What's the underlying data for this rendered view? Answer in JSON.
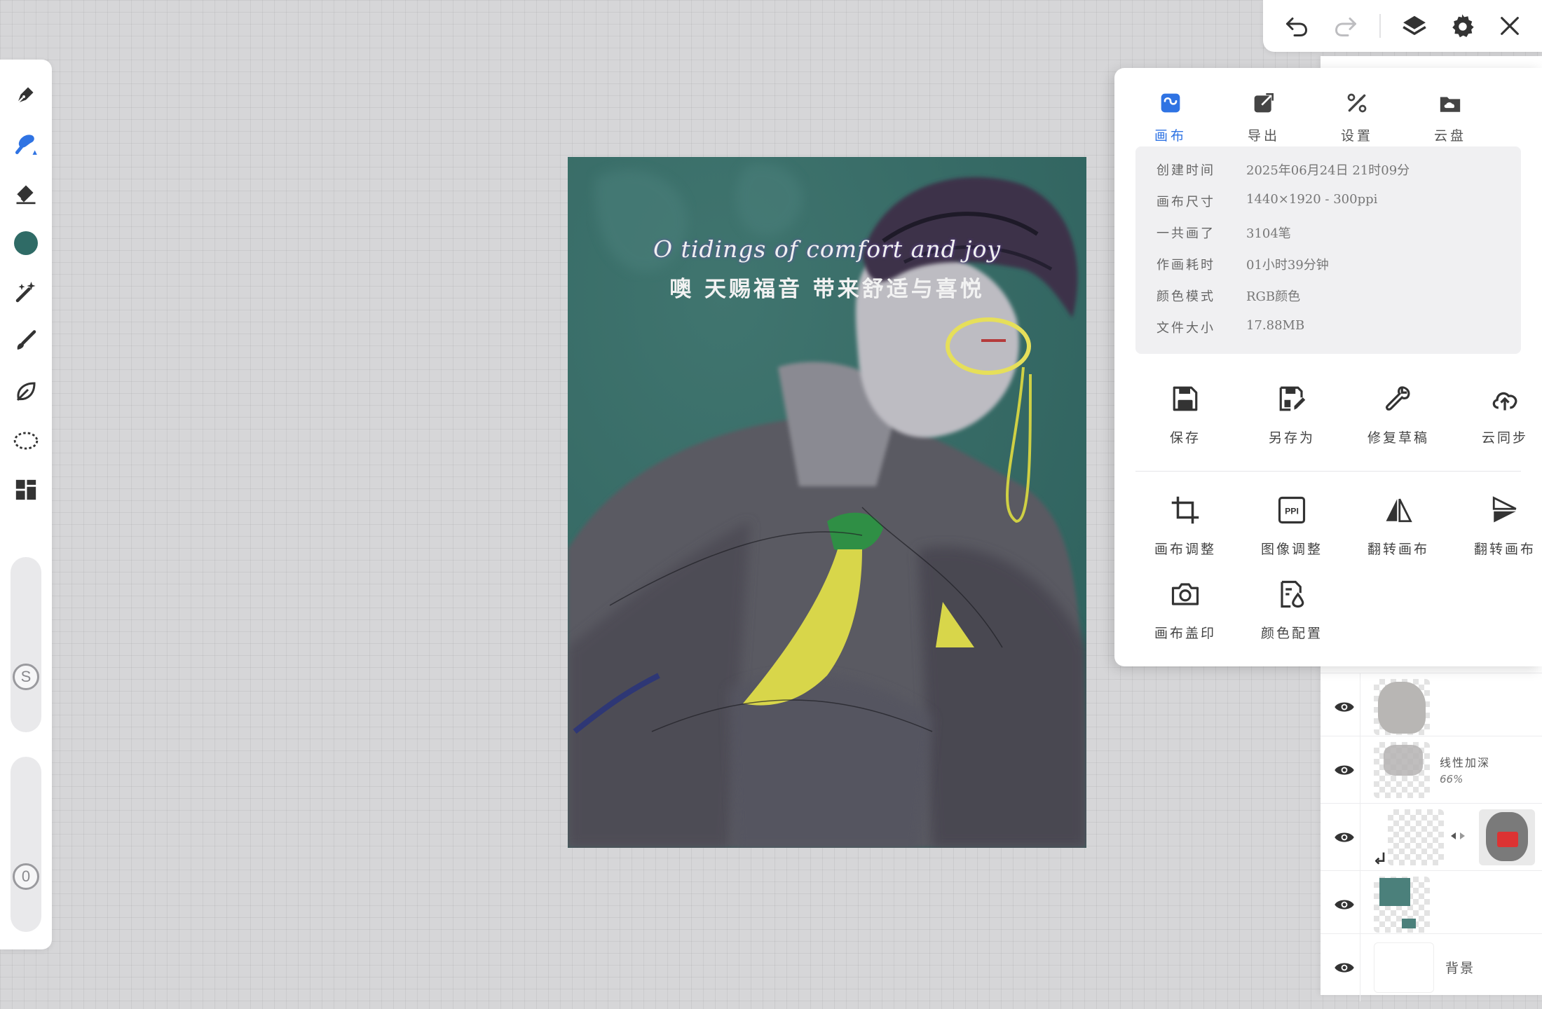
{
  "colors": {
    "accent": "#2f73e3",
    "brush_color": "#2f6b66",
    "icon_dark": "#333333"
  },
  "left_toolbar": {
    "tools": [
      {
        "name": "pen-tool",
        "icon": "pen-nib-icon"
      },
      {
        "name": "brush-tool",
        "icon": "brush-icon",
        "active": true
      },
      {
        "name": "eraser-tool",
        "icon": "eraser-icon"
      },
      {
        "name": "color-tool",
        "icon": "color-swatch-icon"
      },
      {
        "name": "magic-wand-tool",
        "icon": "magic-wand-icon"
      },
      {
        "name": "smudge-tool",
        "icon": "smudge-icon"
      },
      {
        "name": "lasso-fill-tool",
        "icon": "leaf-icon"
      },
      {
        "name": "selection-tool",
        "icon": "lasso-selection-icon"
      },
      {
        "name": "gallery-tool",
        "icon": "grid-icon"
      }
    ],
    "size_slider": {
      "label": "S"
    },
    "opacity_slider": {
      "label": "0"
    }
  },
  "canvas": {
    "caption_en": "O tidings of comfort and joy",
    "caption_zh": "噢 天赐福音 带来舒适与喜悦"
  },
  "top_toolbar": {
    "buttons": [
      "undo-icon",
      "redo-icon",
      "layers-icon",
      "gear-icon",
      "close-icon"
    ]
  },
  "popup": {
    "tabs": [
      {
        "label": "画布",
        "icon": "canvas-icon",
        "active": true
      },
      {
        "label": "导出",
        "icon": "export-icon"
      },
      {
        "label": "设置",
        "icon": "tools-icon"
      },
      {
        "label": "云盘",
        "icon": "cloud-folder-icon"
      }
    ],
    "info": [
      {
        "label": "创建时间",
        "value": "2025年06月24日 21时09分"
      },
      {
        "label": "画布尺寸",
        "value": "1440×1920 - 300ppi"
      },
      {
        "label": "一共画了",
        "value": "3104笔"
      },
      {
        "label": "作画耗时",
        "value": "01小时39分钟"
      },
      {
        "label": "颜色模式",
        "value": "RGB颜色"
      },
      {
        "label": "文件大小",
        "value": "17.88MB"
      }
    ],
    "actions_row1": [
      {
        "label": "保存",
        "icon": "save-icon"
      },
      {
        "label": "另存为",
        "icon": "save-as-icon"
      },
      {
        "label": "修复草稿",
        "icon": "wrench-icon"
      },
      {
        "label": "云同步",
        "icon": "cloud-sync-icon"
      }
    ],
    "actions_row2": [
      {
        "label": "画布调整",
        "icon": "crop-icon"
      },
      {
        "label": "图像调整",
        "icon": "ppi-icon"
      },
      {
        "label": "翻转画布",
        "icon": "flip-horizontal-icon"
      },
      {
        "label": "翻转画布",
        "icon": "flip-vertical-icon"
      }
    ],
    "actions_row3": [
      {
        "label": "画布盖印",
        "icon": "camera-icon"
      },
      {
        "label": "颜色配置",
        "icon": "color-profile-icon"
      }
    ]
  },
  "layers": [
    {
      "name": "",
      "sub": ""
    },
    {
      "name": "线性加深",
      "sub": "66%"
    },
    {
      "name": "",
      "sub": ""
    },
    {
      "name": "",
      "sub": ""
    },
    {
      "name": "背景",
      "sub": ""
    }
  ]
}
